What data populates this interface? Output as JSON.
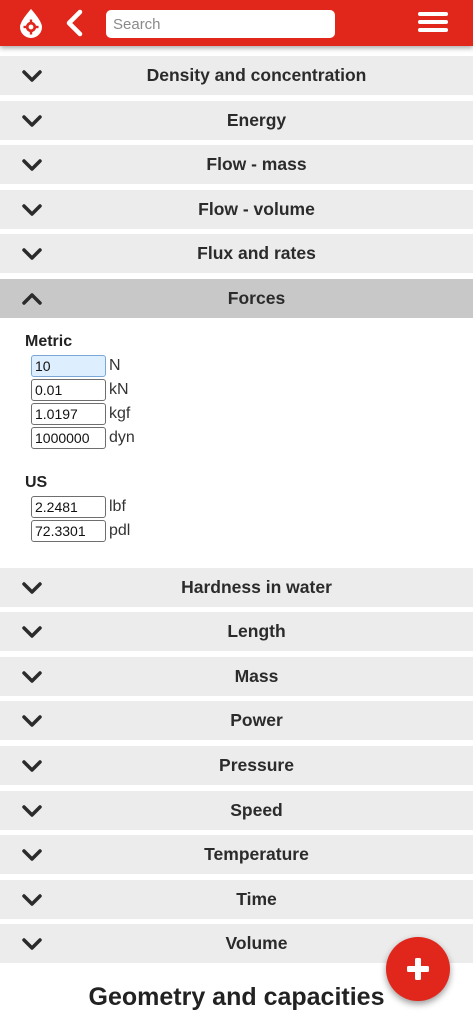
{
  "header": {
    "search_placeholder": "Search",
    "brand_color": "#e1261c"
  },
  "categories_above": [
    {
      "label": "Density and concentration"
    },
    {
      "label": "Energy"
    },
    {
      "label": "Flow - mass"
    },
    {
      "label": "Flow - volume"
    },
    {
      "label": "Flux and rates"
    }
  ],
  "open_category": {
    "label": "Forces",
    "metric": {
      "title": "Metric",
      "rows": [
        {
          "value": "10",
          "unit": "N"
        },
        {
          "value": "0.01",
          "unit": "kN"
        },
        {
          "value": "1.0197",
          "unit": "kgf"
        },
        {
          "value": "1000000",
          "unit": "dyn"
        }
      ]
    },
    "us": {
      "title": "US",
      "rows": [
        {
          "value": "2.2481",
          "unit": "lbf"
        },
        {
          "value": "72.3301",
          "unit": "pdl"
        }
      ]
    }
  },
  "categories_below": [
    {
      "label": "Hardness in water"
    },
    {
      "label": "Length"
    },
    {
      "label": "Mass"
    },
    {
      "label": "Power"
    },
    {
      "label": "Pressure"
    },
    {
      "label": "Speed"
    },
    {
      "label": "Temperature"
    },
    {
      "label": "Time"
    },
    {
      "label": "Volume"
    }
  ],
  "section_heading": "Geometry and capacities",
  "icons": {
    "logo": "drop-gear-icon",
    "back": "chevron-left-icon",
    "menu": "hamburger-menu-icon",
    "expand": "chevron-down-icon",
    "collapse": "chevron-up-icon",
    "fab": "plus-icon"
  }
}
